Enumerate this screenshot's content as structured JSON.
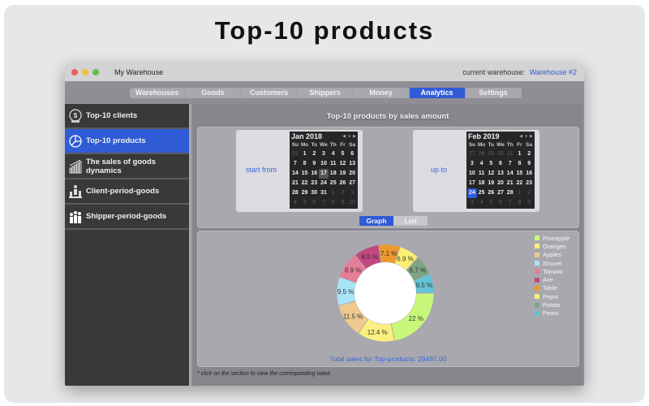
{
  "promo": {
    "title": "Top-10 products"
  },
  "window": {
    "title": "My Warehouse",
    "current_warehouse_label": "current warehouse:",
    "current_warehouse_value": "Warehouse #2"
  },
  "tabs": [
    {
      "label": "Warehouses",
      "active": false
    },
    {
      "label": "Goods",
      "active": false
    },
    {
      "label": "Customers",
      "active": false
    },
    {
      "label": "Shippers",
      "active": false
    },
    {
      "label": "Money",
      "active": false
    },
    {
      "label": "Analytics",
      "active": true
    },
    {
      "label": "Settings",
      "active": false
    }
  ],
  "sidebar": {
    "items": [
      {
        "label": "Top-10 clients",
        "icon": "money-bag-icon",
        "active": false
      },
      {
        "label": "Top-10 products",
        "icon": "pie-chart-icon",
        "active": true
      },
      {
        "label": "The sales of goods dynamics",
        "icon": "bar-growth-icon",
        "active": false
      },
      {
        "label": "Client-period-goods",
        "icon": "people-chart-icon",
        "active": false
      },
      {
        "label": "Shipper-period-goods",
        "icon": "shippers-chart-icon",
        "active": false
      }
    ]
  },
  "content": {
    "title": "Top-10 products by sales amount",
    "start_label": "start from",
    "end_label": "up to",
    "view_toggle": {
      "graph": "Graph",
      "list": "List",
      "active": "graph"
    },
    "total_text": "Total sales for Top-products: 29487.00",
    "footnote": "* click on the section to view the corresponding value"
  },
  "calendars": {
    "dow": [
      "Su",
      "Mo",
      "Tu",
      "We",
      "Th",
      "Fr",
      "Sa"
    ],
    "start": {
      "month": "Jan 2018",
      "days": [
        [
          "31",
          1
        ],
        [
          "1",
          0
        ],
        [
          "2",
          0
        ],
        [
          "3",
          0
        ],
        [
          "4",
          0
        ],
        [
          "5",
          0
        ],
        [
          "6",
          0
        ],
        [
          "7",
          0
        ],
        [
          "8",
          0
        ],
        [
          "9",
          0
        ],
        [
          "10",
          0
        ],
        [
          "11",
          0
        ],
        [
          "12",
          0
        ],
        [
          "13",
          0
        ],
        [
          "14",
          0
        ],
        [
          "15",
          0
        ],
        [
          "16",
          0
        ],
        [
          "17",
          2
        ],
        [
          "18",
          0
        ],
        [
          "19",
          0
        ],
        [
          "20",
          0
        ],
        [
          "21",
          0
        ],
        [
          "22",
          0
        ],
        [
          "23",
          0
        ],
        [
          "24",
          0
        ],
        [
          "25",
          0
        ],
        [
          "26",
          0
        ],
        [
          "27",
          0
        ],
        [
          "28",
          0
        ],
        [
          "29",
          0
        ],
        [
          "30",
          0
        ],
        [
          "31",
          0
        ],
        [
          "1",
          1
        ],
        [
          "2",
          1
        ],
        [
          "3",
          1
        ],
        [
          "4",
          1
        ],
        [
          "5",
          1
        ],
        [
          "6",
          1
        ],
        [
          "7",
          1
        ],
        [
          "8",
          1
        ],
        [
          "9",
          1
        ],
        [
          "10",
          1
        ]
      ]
    },
    "end": {
      "month": "Feb 2019",
      "days": [
        [
          "27",
          1
        ],
        [
          "28",
          1
        ],
        [
          "29",
          1
        ],
        [
          "30",
          1
        ],
        [
          "31",
          1
        ],
        [
          "1",
          0
        ],
        [
          "2",
          0
        ],
        [
          "3",
          0
        ],
        [
          "4",
          0
        ],
        [
          "5",
          0
        ],
        [
          "6",
          0
        ],
        [
          "7",
          0
        ],
        [
          "8",
          0
        ],
        [
          "9",
          0
        ],
        [
          "10",
          0
        ],
        [
          "11",
          0
        ],
        [
          "12",
          0
        ],
        [
          "13",
          0
        ],
        [
          "14",
          0
        ],
        [
          "15",
          0
        ],
        [
          "16",
          0
        ],
        [
          "17",
          0
        ],
        [
          "18",
          0
        ],
        [
          "19",
          0
        ],
        [
          "20",
          0
        ],
        [
          "21",
          0
        ],
        [
          "22",
          0
        ],
        [
          "23",
          0
        ],
        [
          "24",
          3
        ],
        [
          "25",
          0
        ],
        [
          "26",
          0
        ],
        [
          "27",
          0
        ],
        [
          "28",
          0
        ],
        [
          "1",
          1
        ],
        [
          "2",
          1
        ],
        [
          "3",
          1
        ],
        [
          "4",
          1
        ],
        [
          "5",
          1
        ],
        [
          "6",
          1
        ],
        [
          "7",
          1
        ],
        [
          "8",
          1
        ],
        [
          "9",
          1
        ]
      ]
    }
  },
  "chart_data": {
    "type": "pie",
    "donut": true,
    "title": "Top-10 products by sales amount",
    "categories": [
      "Pineapple",
      "Oranges",
      "Apples",
      "Shovel",
      "Tomato",
      "Axe",
      "Table",
      "Pepsi",
      "Potato",
      "Pears"
    ],
    "values": [
      22,
      12.4,
      11.5,
      9.5,
      8.9,
      8.5,
      7.1,
      6.9,
      6.7,
      6.5
    ],
    "labels": [
      "22 %",
      "12.4 %",
      "11.5 %",
      "9.5 %",
      "8.9 %",
      "8.5 %",
      "7.1 %",
      "6.9 %",
      "6.7 %",
      "6.5 %"
    ],
    "colors": [
      "#c9f77a",
      "#fbef7f",
      "#f0c98c",
      "#a9e4f7",
      "#e57e96",
      "#c2487f",
      "#ec9a2b",
      "#fbef73",
      "#7ea484",
      "#62c3d6"
    ],
    "start_angle": "east, clockwise",
    "legend_position": "top-right",
    "total": 29487.0
  }
}
